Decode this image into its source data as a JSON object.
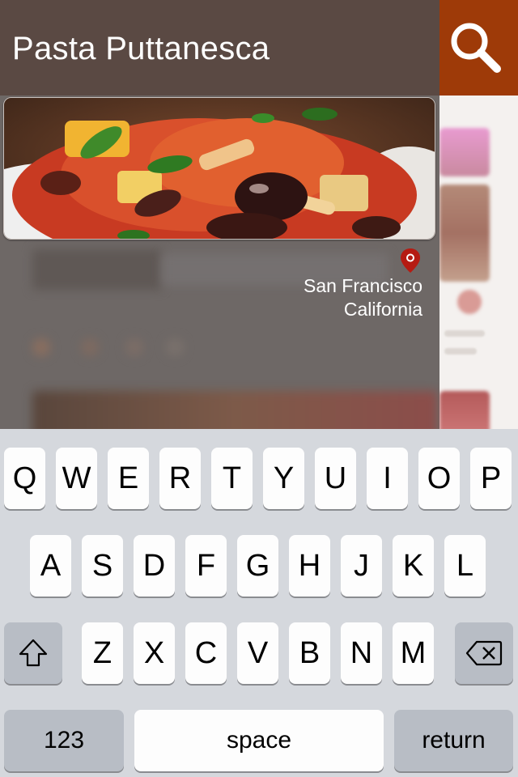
{
  "header": {
    "title": "Pasta Puttanesca"
  },
  "search": {
    "icon": "search-icon",
    "color": "#9e3a08"
  },
  "location": {
    "icon": "location-pin-icon",
    "city": "San Francisco",
    "state": "California",
    "pin_color": "#b51b12"
  },
  "keyboard": {
    "row1": [
      "Q",
      "W",
      "E",
      "R",
      "T",
      "Y",
      "U",
      "I",
      "O",
      "P"
    ],
    "row2": [
      "A",
      "S",
      "D",
      "F",
      "G",
      "H",
      "J",
      "K",
      "L"
    ],
    "row3": [
      "Z",
      "X",
      "C",
      "V",
      "B",
      "N",
      "M"
    ],
    "shift_icon": "shift-icon",
    "delete_icon": "backspace-icon",
    "numbers_label": "123",
    "space_label": "space",
    "return_label": "return"
  }
}
